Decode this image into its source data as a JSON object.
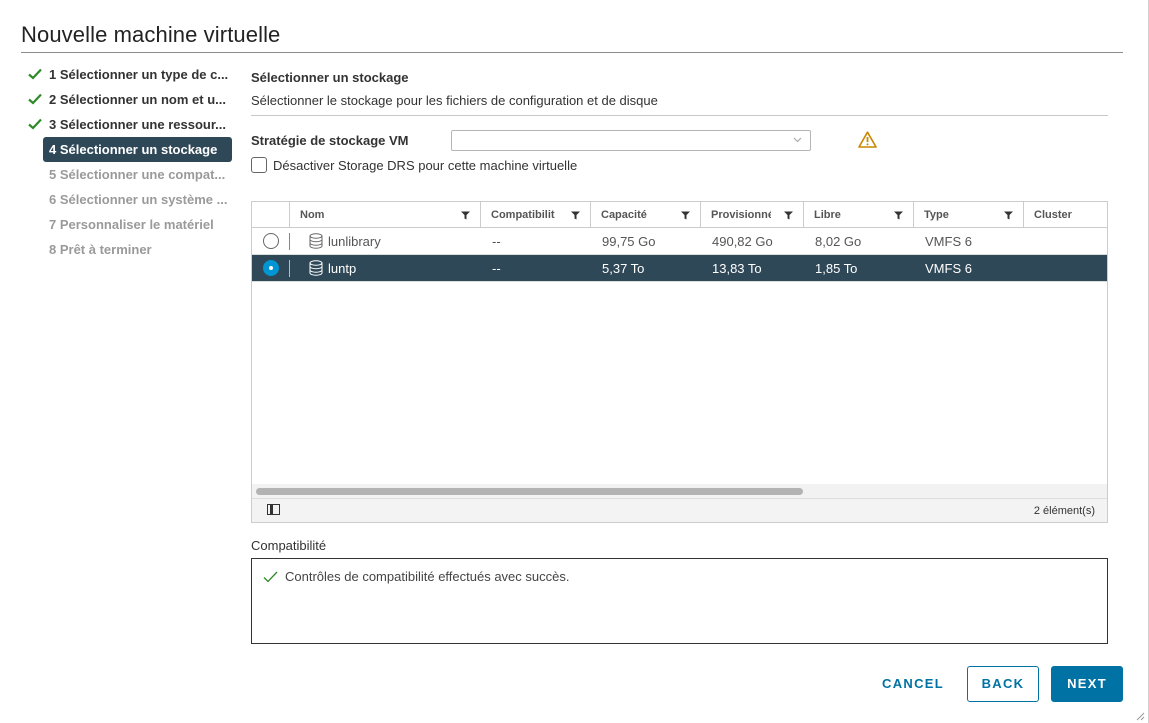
{
  "dialog": {
    "title": "Nouvelle machine virtuelle"
  },
  "steps": [
    {
      "label": "1 Sélectionner un type de c...",
      "state": "done"
    },
    {
      "label": "2 Sélectionner un nom et u...",
      "state": "done"
    },
    {
      "label": "3 Sélectionner une ressour...",
      "state": "done"
    },
    {
      "label": "4 Sélectionner un stockage",
      "state": "active"
    },
    {
      "label": "5 Sélectionner une compat...",
      "state": "pending"
    },
    {
      "label": "6 Sélectionner un système ...",
      "state": "pending"
    },
    {
      "label": "7 Personnaliser le matériel",
      "state": "pending"
    },
    {
      "label": "8 Prêt à terminer",
      "state": "pending"
    }
  ],
  "main": {
    "title": "Sélectionner un stockage",
    "subtitle": "Sélectionner le stockage pour les fichiers de configuration et de disque",
    "policy_label": "Stratégie de stockage VM",
    "policy_value": "",
    "drs_label": "Désactiver Storage DRS pour cette machine virtuelle",
    "drs_checked": false
  },
  "grid": {
    "columns": [
      "Nom",
      "Compatibilit",
      "Capacité",
      "Provisionné",
      "Libre",
      "Type",
      "Cluster"
    ],
    "rows": [
      {
        "name": "lunlibrary",
        "compat": "--",
        "capacity": "99,75 Go",
        "provisioned": "490,82 Go",
        "free": "8,02 Go",
        "type": "VMFS 6",
        "cluster": "",
        "selected": false
      },
      {
        "name": "luntp",
        "compat": "--",
        "capacity": "5,37 To",
        "provisioned": "13,83 To",
        "free": "1,85 To",
        "type": "VMFS 6",
        "cluster": "",
        "selected": true
      }
    ],
    "count": "2 élément(s)"
  },
  "compat": {
    "label": "Compatibilité",
    "message": "Contrôles de compatibilité effectués avec succès."
  },
  "buttons": {
    "cancel": "CANCEL",
    "back": "BACK",
    "next": "NEXT"
  },
  "colors": {
    "accent": "#0072a3",
    "selected_row": "#2f4858",
    "check_green": "#2e8a27",
    "warning": "#c98700"
  }
}
